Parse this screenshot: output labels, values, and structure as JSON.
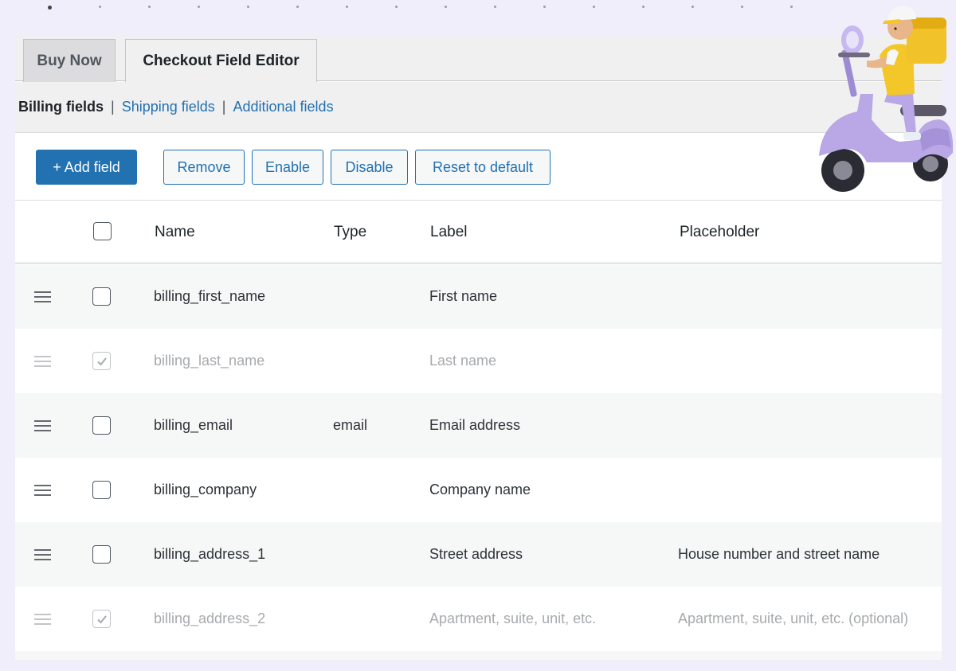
{
  "tabs": [
    {
      "label": "Buy Now",
      "active": false
    },
    {
      "label": "Checkout Field Editor",
      "active": true
    }
  ],
  "subnav": {
    "current": "Billing fields",
    "links": [
      "Shipping fields",
      "Additional fields"
    ],
    "separator": "|"
  },
  "toolbar": {
    "add_label": "+ Add field",
    "remove_label": "Remove",
    "enable_label": "Enable",
    "disable_label": "Disable",
    "reset_label": "Reset to default"
  },
  "table": {
    "headers": {
      "name": "Name",
      "type": "Type",
      "label": "Label",
      "placeholder": "Placeholder"
    },
    "rows": [
      {
        "name": "billing_first_name",
        "type": "",
        "label": "First name",
        "placeholder": "",
        "disabled": false,
        "checked": false
      },
      {
        "name": "billing_last_name",
        "type": "",
        "label": "Last name",
        "placeholder": "",
        "disabled": true,
        "checked": true
      },
      {
        "name": "billing_email",
        "type": "email",
        "label": "Email address",
        "placeholder": "",
        "disabled": false,
        "checked": false
      },
      {
        "name": "billing_company",
        "type": "",
        "label": "Company name",
        "placeholder": "",
        "disabled": false,
        "checked": false
      },
      {
        "name": "billing_address_1",
        "type": "",
        "label": "Street address",
        "placeholder": "House number and street name",
        "disabled": false,
        "checked": false
      },
      {
        "name": "billing_address_2",
        "type": "",
        "label": "Apartment, suite, unit, etc.",
        "placeholder": "Apartment, suite, unit, etc. (optional)",
        "disabled": true,
        "checked": true
      }
    ]
  },
  "colors": {
    "accent": "#2271b1",
    "page_background": "#f1eefb",
    "disabled_text": "#a7aaad"
  },
  "icons": {
    "row_handle": "drag-handle-icon",
    "row_check": "checkmark-icon",
    "mascot": "delivery-scooter-illustration"
  }
}
